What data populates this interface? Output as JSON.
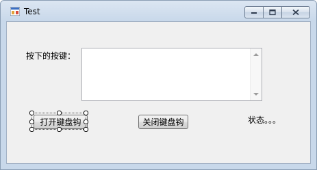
{
  "window": {
    "title": "Test"
  },
  "form": {
    "keys_label": "按下的按键：",
    "keys_textbox_value": "",
    "open_hook_button": "打开键盘钩",
    "close_hook_button": "关闭键盘钩",
    "status_label": "状态。。。"
  },
  "icons": {
    "app": "app-icon",
    "minimize": "minimize-icon",
    "maximize": "maximize-icon",
    "close": "close-icon"
  }
}
